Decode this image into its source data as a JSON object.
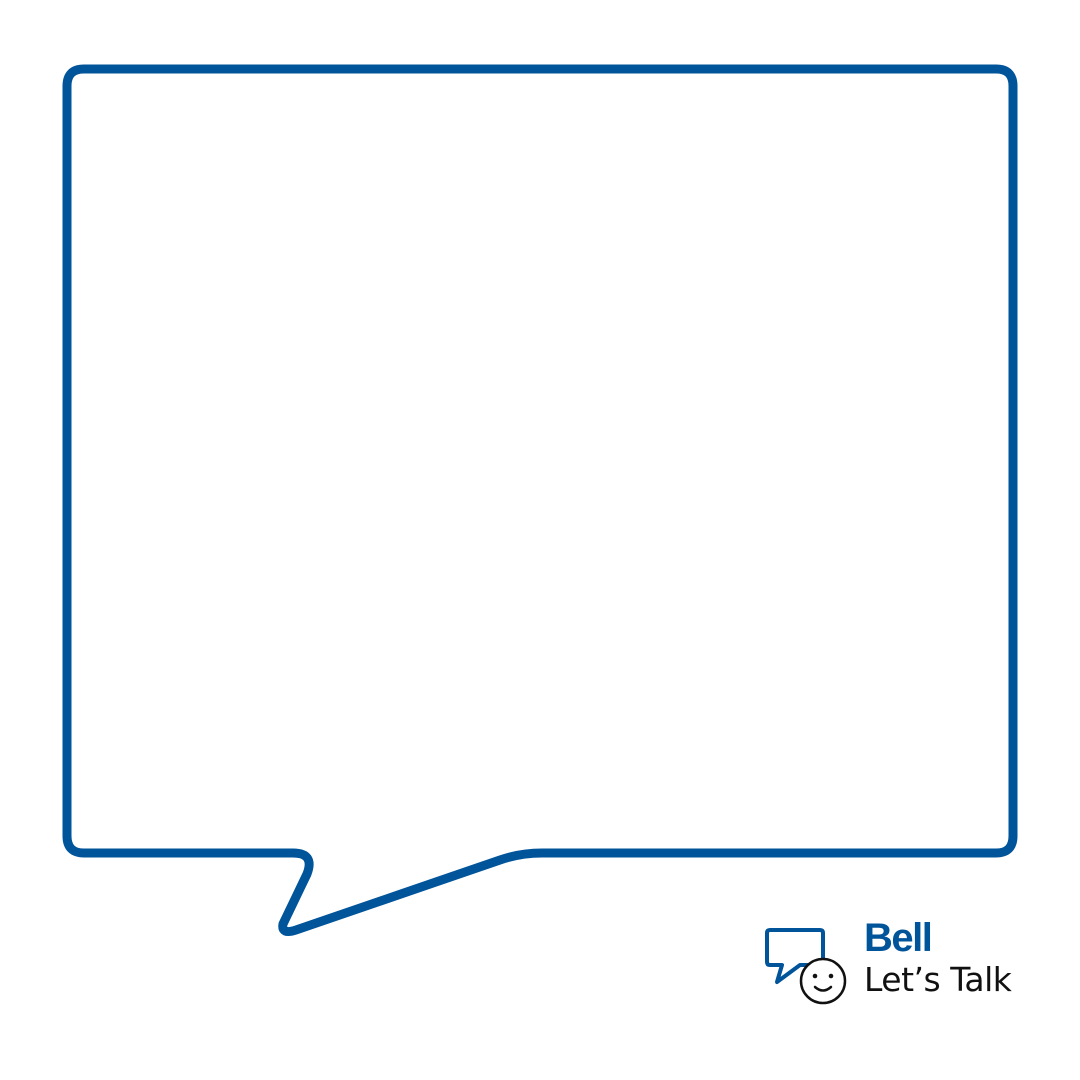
{
  "colors": {
    "bubble_outline": "#00549a",
    "brand_blue": "#00549a",
    "tagline_text": "#111111",
    "background": "#ffffff"
  },
  "logo": {
    "brand_name": "Bell",
    "tagline": "Let’s Talk",
    "icon": "speech-bubble-smiley-icon"
  }
}
